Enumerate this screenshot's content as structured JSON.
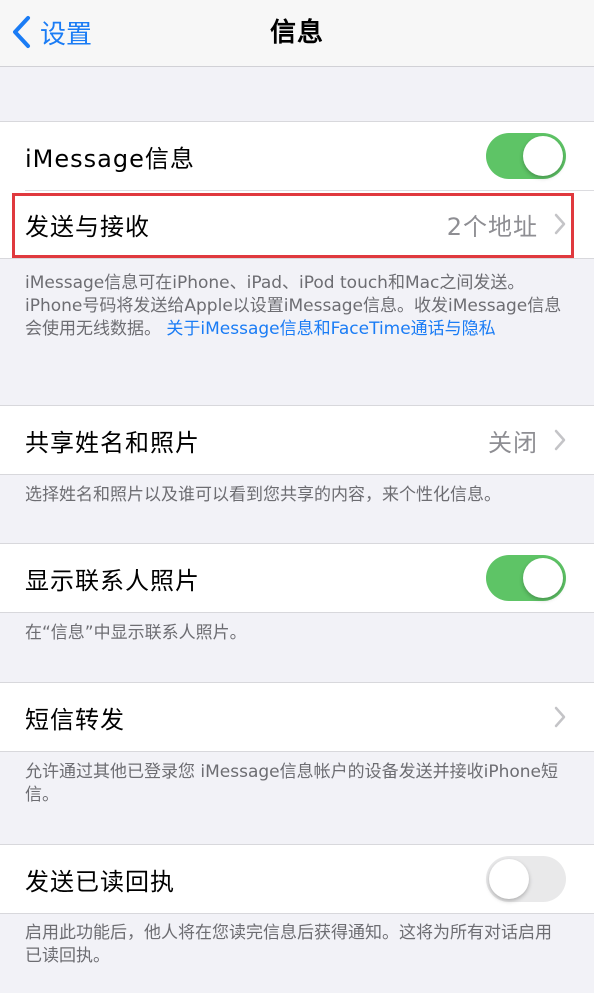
{
  "navbar": {
    "back_label": "设置",
    "title": "信息"
  },
  "imessage": {
    "label": "iMessage信息",
    "toggle": "on"
  },
  "send_receive": {
    "label": "发送与接收",
    "value": "2个地址"
  },
  "imessage_footnote": {
    "text": "iMessage信息可在iPhone、iPad、iPod touch和Mac之间发送。iPhone号码将发送给Apple以设置iMessage信息。收发iMessage信息会使用无线数据。",
    "link": "关于iMessage信息和FaceTime通话与隐私"
  },
  "share_name": {
    "label": "共享姓名和照片",
    "value": "关闭",
    "footnote": "选择姓名和照片以及谁可以看到您共享的内容，来个性化信息。"
  },
  "contact_photos": {
    "label": "显示联系人照片",
    "toggle": "on",
    "footnote": "在“信息”中显示联系人照片。"
  },
  "sms_forwarding": {
    "label": "短信转发",
    "footnote": "允许通过其他已登录您 iMessage信息帐户的设备发送并接收iPhone短信。"
  },
  "read_receipts": {
    "label": "发送已读回执",
    "toggle": "off",
    "footnote": "启用此功能后，他人将在您读完信息后获得通知。这将为所有对话启用已读回执。"
  },
  "colors": {
    "accent": "#1a7cf5",
    "toggle_on": "#5ec466",
    "highlight": "#e0393e"
  },
  "icons": {
    "back": "chevron-left-icon",
    "disclosure": "chevron-right-icon"
  }
}
